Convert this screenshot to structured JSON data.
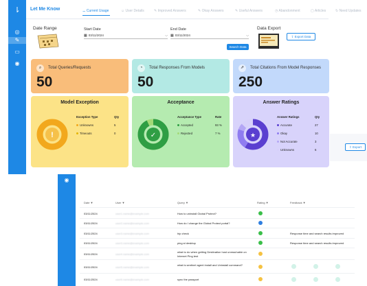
{
  "app": {
    "title": "Let Me Know"
  },
  "sidebar": {
    "icons": [
      {
        "name": "chat-icon",
        "glyph": "◎"
      },
      {
        "name": "edit-icon",
        "glyph": "✎"
      },
      {
        "name": "clipboard-icon",
        "glyph": "▭"
      },
      {
        "name": "broadcast-icon",
        "glyph": "◉"
      }
    ]
  },
  "filters": {
    "date_range_label": "Date Range",
    "start_label": "Start Date",
    "start_value": "03/11/2024",
    "end_label": "End Date",
    "end_value": "03/11/2024",
    "search_button": "Search Data",
    "export_label": "Data Export",
    "export_button": "Export Data"
  },
  "summary_cards": [
    {
      "title": "Total Queries/Requests",
      "value": "50",
      "color": "#f9bd7a"
    },
    {
      "title": "Total Responses From Models",
      "value": "50",
      "color": "#b3e9e4"
    },
    {
      "title": "Total Citations From Model Responses",
      "value": "250",
      "color": "#c2d9fb"
    }
  ],
  "model_exception": {
    "title": "Model Exception",
    "headers": [
      "Exception Type",
      "Qty"
    ],
    "rows": [
      {
        "label": "Unknowns",
        "qty": "5",
        "color": "#f2a81d"
      },
      {
        "label": "Timeouts",
        "qty": "0",
        "color": "#e4b400"
      }
    ],
    "color": "#fce387"
  },
  "acceptance": {
    "title": "Acceptance",
    "headers": [
      "Acceptance Type",
      "Rate"
    ],
    "rows": [
      {
        "label": "Accepted",
        "qty": "93 %",
        "color": "#2f9e44"
      },
      {
        "label": "Rejected",
        "qty": "7 %",
        "color": "#a3d977"
      }
    ],
    "color": "#b5ebb0"
  },
  "answer_ratings": {
    "title": "Answer Ratings",
    "headers": [
      "Answer Ratings",
      "Qty"
    ],
    "rows": [
      {
        "label": "Accurate",
        "qty": "27",
        "color": "#5a3fd0"
      },
      {
        "label": "Okay",
        "qty": "10",
        "color": "#8f7cf0"
      },
      {
        "label": "Not Accurate",
        "qty": "3",
        "color": "#b4a6f5"
      },
      {
        "label": "Unknowns",
        "qty": "6",
        "color": "#d7d0fa"
      }
    ],
    "color": "#d8d3fb"
  },
  "right_export_button": "Export",
  "tabs": [
    {
      "label": "Current Usage",
      "icon": "⚊"
    },
    {
      "label": "User Details",
      "icon": "☺"
    },
    {
      "label": "Improved Answers",
      "icon": "✎"
    },
    {
      "label": "Okay Answers",
      "icon": "✎"
    },
    {
      "label": "Useful Answers",
      "icon": "✎"
    },
    {
      "label": "Abandonment",
      "icon": "◷"
    },
    {
      "label": "Articles",
      "icon": "▢"
    },
    {
      "label": "Need Updates",
      "icon": "↻"
    }
  ],
  "usage_table": {
    "headers": [
      "Date ▼",
      "User ▼",
      "Query ▼",
      "Rating ▼",
      "Feedback ▼"
    ],
    "rows": [
      {
        "date": "03/11/2024",
        "user": "user1.name@example.com",
        "query": "How to uninstall Global Protect?",
        "rating_color": "#3bbf4a",
        "feedback": ""
      },
      {
        "date": "03/11/2024",
        "user": "user2.name@example.com",
        "query": "How do I change the Global Protect portal?",
        "rating_color": "#2f7fe0",
        "feedback": ""
      },
      {
        "date": "03/11/2024",
        "user": "user3.name@example.com",
        "query": "hip check",
        "rating_color": "#3bbf4a",
        "feedback": "Response time and search results improved"
      },
      {
        "date": "03/11/2024",
        "user": "user3.name@example.com",
        "query": "ping st desktop",
        "rating_color": "#3bbf4a",
        "feedback": "Response time and search results improved"
      },
      {
        "date": "03/11/2024",
        "user": "user4.name@example.com",
        "query": "what to do when getting Destination host unreachable on Internet Ping test",
        "rating_color": "#f5c242",
        "feedback": ""
      },
      {
        "date": "03/11/2024",
        "user": "user5.name@example.com",
        "query": "what is sentinel agent install and Uninstall command?",
        "rating_color": "#f5c242",
        "feedback": ""
      },
      {
        "date": "03/11/2024",
        "user": "user6.name@example.com",
        "query": "sync the passport",
        "rating_color": "#f5c242",
        "feedback": ""
      }
    ]
  }
}
